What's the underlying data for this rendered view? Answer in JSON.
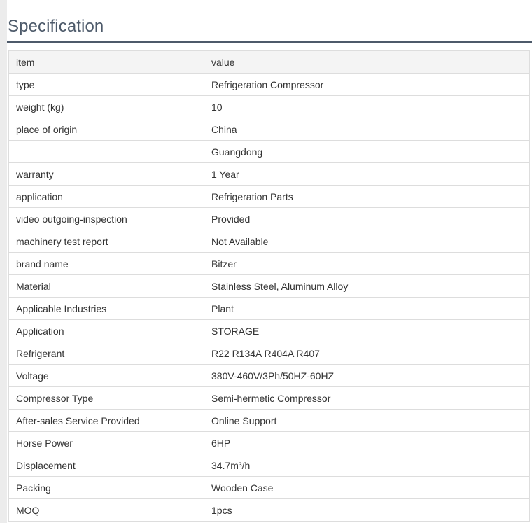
{
  "title": "Specification",
  "header": {
    "item": "item",
    "value": "value"
  },
  "rows": [
    {
      "item": "type",
      "value": "Refrigeration Compressor"
    },
    {
      "item": "weight (kg)",
      "value": "10"
    },
    {
      "item": "place of origin",
      "value": "China"
    },
    {
      "item": "",
      "value": "Guangdong"
    },
    {
      "item": "warranty",
      "value": "1 Year"
    },
    {
      "item": "application",
      "value": "Refrigeration Parts"
    },
    {
      "item": "video outgoing-inspection",
      "value": "Provided"
    },
    {
      "item": "machinery test report",
      "value": "Not Available"
    },
    {
      "item": "brand name",
      "value": "Bitzer"
    },
    {
      "item": "Material",
      "value": "Stainless Steel, Aluminum Alloy"
    },
    {
      "item": "Applicable Industries",
      "value": "Plant"
    },
    {
      "item": "Application",
      "value": "STORAGE"
    },
    {
      "item": "Refrigerant",
      "value": "R22 R134A R404A R407"
    },
    {
      "item": "Voltage",
      "value": "380V-460V/3Ph/50HZ-60HZ"
    },
    {
      "item": "Compressor Type",
      "value": "Semi-hermetic Compressor"
    },
    {
      "item": "After-sales Service Provided",
      "value": "Online Support"
    },
    {
      "item": "Horse Power",
      "value": "6HP"
    },
    {
      "item": "Displacement",
      "value": "34.7m³/h"
    },
    {
      "item": "Packing",
      "value": "Wooden Case"
    },
    {
      "item": "MOQ",
      "value": "1pcs"
    }
  ]
}
